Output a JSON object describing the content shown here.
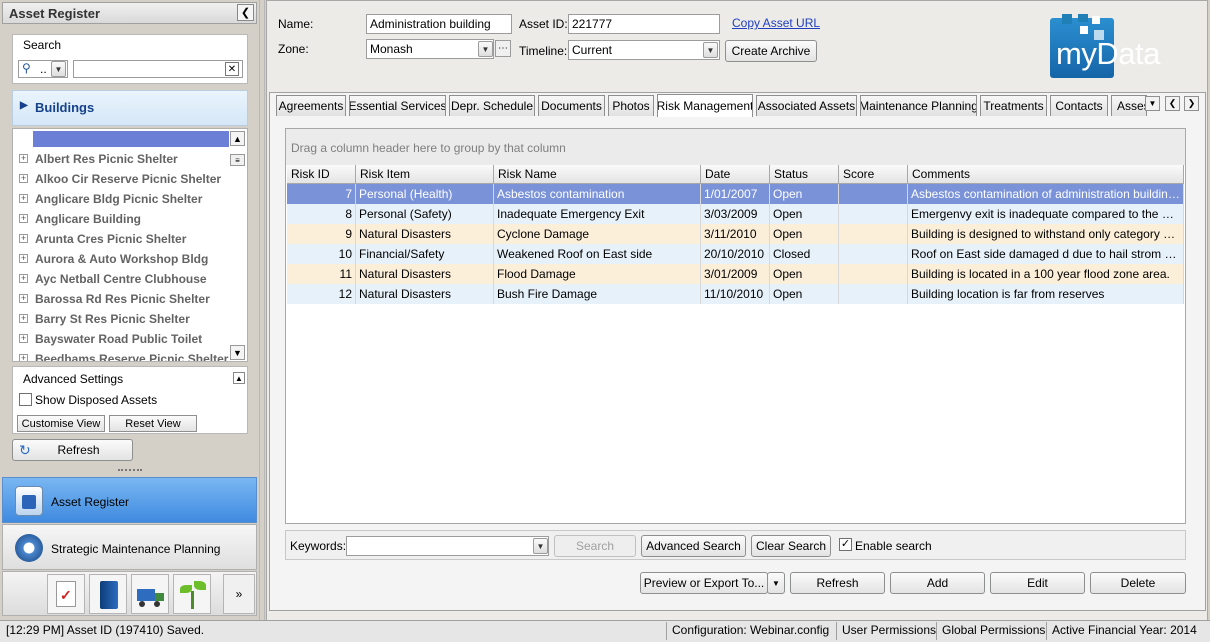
{
  "left": {
    "header": "Asset Register",
    "search_label": "Search",
    "search_filter_value": "..",
    "search_placeholder": "",
    "buildings_label": "Buildings",
    "tree_items": [
      "Albert Res Picnic Shelter",
      "Alkoo Cir Reserve Picnic Shelter",
      "Anglicare Bldg Picnic Shelter",
      "Anglicare Building",
      "Arunta Cres Picnic Shelter",
      "Aurora & Auto Workshop Bldg",
      "Ayc Netball Centre Clubhouse",
      "Barossa Rd Res Picnic Shelter",
      "Barry St Res Picnic Shelter",
      "Bayswater Road Public Toilet",
      "Beedhams Reserve Picnic Shelter"
    ],
    "advanced_label": "Advanced Settings",
    "show_disposed_label": "Show Disposed Assets",
    "show_disposed_checked": false,
    "customise_view_label": "Customise View",
    "reset_view_label": "Reset View",
    "refresh_label": "Refresh",
    "nav": {
      "asset_register": "Asset Register",
      "strategic_maintenance": "Strategic Maintenance Planning"
    }
  },
  "header": {
    "name_label": "Name:",
    "name_value": "Administration building",
    "asset_id_label": "Asset ID:",
    "asset_id_value": "221777",
    "copy_url_label": "Copy Asset URL",
    "zone_label": "Zone:",
    "zone_value": "Monash",
    "timeline_label": "Timeline:",
    "timeline_value": "Current",
    "create_archive_label": "Create Archive",
    "logo_text": "myData"
  },
  "tabs": [
    "Agreements",
    "Essential Services",
    "Depr. Schedule",
    "Documents",
    "Photos",
    "Risk Management",
    "Associated Assets",
    "Maintenance Planning",
    "Treatments",
    "Contacts",
    "Asses"
  ],
  "active_tab": "Risk Management",
  "grid": {
    "group_hint": "Drag a column header here to group by that column",
    "columns": [
      "Risk ID",
      "Risk Item",
      "Risk Name",
      "Date",
      "Status",
      "Score",
      "Comments"
    ],
    "rows": [
      {
        "id": "7",
        "item": "Personal (Health)",
        "name": "Asbestos contamination",
        "date": "1/01/2007",
        "status": "Open",
        "score": "",
        "comments": "Asbestos contamination of administration building mat…"
      },
      {
        "id": "8",
        "item": "Personal (Safety)",
        "name": "Inadequate Emergency Exit",
        "date": "3/03/2009",
        "status": "Open",
        "score": "",
        "comments": "Emergenvy exit is inadequate compared to the numb…"
      },
      {
        "id": "9",
        "item": "Natural Disasters",
        "name": "Cyclone Damage",
        "date": "3/11/2010",
        "status": "Open",
        "score": "",
        "comments": "Building is designed to withstand only category one c…"
      },
      {
        "id": "10",
        "item": "Financial/Safety",
        "name": "Weakened Roof on East side",
        "date": "20/10/2010",
        "status": "Closed",
        "score": "",
        "comments": "Roof  on East side damaged d due to  hail strom on 3/…"
      },
      {
        "id": "11",
        "item": "Natural Disasters",
        "name": "Flood Damage",
        "date": "3/01/2009",
        "status": "Open",
        "score": "",
        "comments": "Building is located in a 100 year flood zone area."
      },
      {
        "id": "12",
        "item": "Natural Disasters",
        "name": "Bush Fire Damage",
        "date": "11/10/2010",
        "status": "Open",
        "score": "",
        "comments": "Building location is far from  reserves"
      }
    ]
  },
  "search_bar": {
    "keywords_label": "Keywords:",
    "keywords_value": "",
    "search_label": "Search",
    "advanced_search_label": "Advanced Search",
    "clear_search_label": "Clear Search",
    "enable_search_label": "Enable search",
    "enable_search_checked": true
  },
  "actions": {
    "preview_export_label": "Preview or Export To...",
    "refresh_label": "Refresh",
    "add_label": "Add",
    "edit_label": "Edit",
    "delete_label": "Delete"
  },
  "status": {
    "message": "[12:29 PM] Asset ID (197410) Saved.",
    "configuration": "Configuration: Webinar.config",
    "user_permissions": "User Permissions",
    "global_permissions": "Global Permissions",
    "financial_year": "Active Financial Year: 2014"
  },
  "colors": {
    "selected_row": "#7a92d8",
    "row_alt_peach": "#fcefd9",
    "row_alt_blue": "#e7f1fa",
    "link": "#1f3fbf",
    "logo_bg": "#1f7fb6",
    "logo_text": "#1f7fb6"
  }
}
